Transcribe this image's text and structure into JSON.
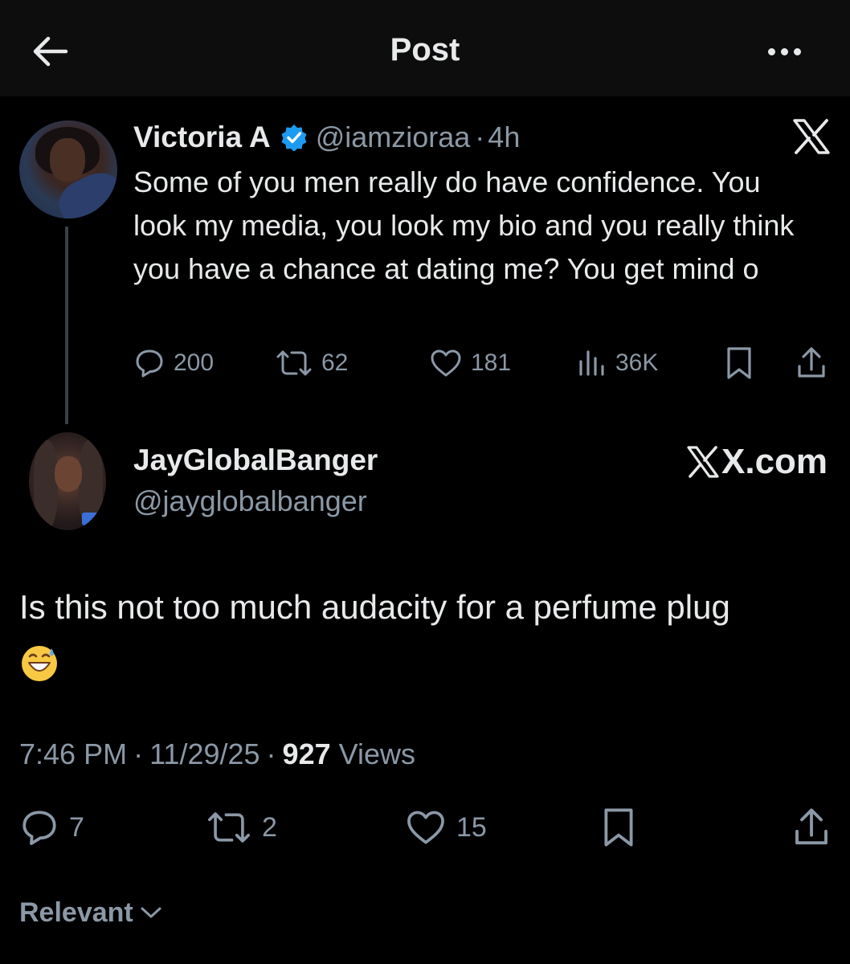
{
  "header": {
    "title": "Post",
    "back_icon": "arrow-left-icon",
    "more_icon": "more-horizontal-icon"
  },
  "quoted_post": {
    "display_name": "Victoria A",
    "verified": true,
    "handle": "@iamzioraa",
    "separator": "·",
    "time": "4h",
    "text": "Some of you men really do have confidence. You look my media, you look my bio and you really think you have a chance at dating me? You get mind o",
    "stats": {
      "replies": "200",
      "reposts": "62",
      "likes": "181",
      "views": "36K"
    },
    "platform_logo": "x-logo-icon"
  },
  "post": {
    "display_name": "JayGlobalBanger",
    "handle": "@jayglobalbanger",
    "watermark": "X.com",
    "text": "Is this not too much audacity for a perfume plug",
    "emoji": "grinning-face-with-sweat",
    "time": "7:46 PM",
    "date": "11/29/25",
    "separator": "·",
    "views_count": "927",
    "views_label": "Views",
    "stats": {
      "replies": "7",
      "reposts": "2",
      "likes": "15"
    }
  },
  "sort": {
    "label": "Relevant"
  },
  "colors": {
    "background": "#000000",
    "header_bg": "#0d0d0d",
    "primary_text": "#e7e9ea",
    "secondary_text": "#8b98a5",
    "verified_blue": "#1d9bf0",
    "thread_line": "#3a3f44"
  }
}
